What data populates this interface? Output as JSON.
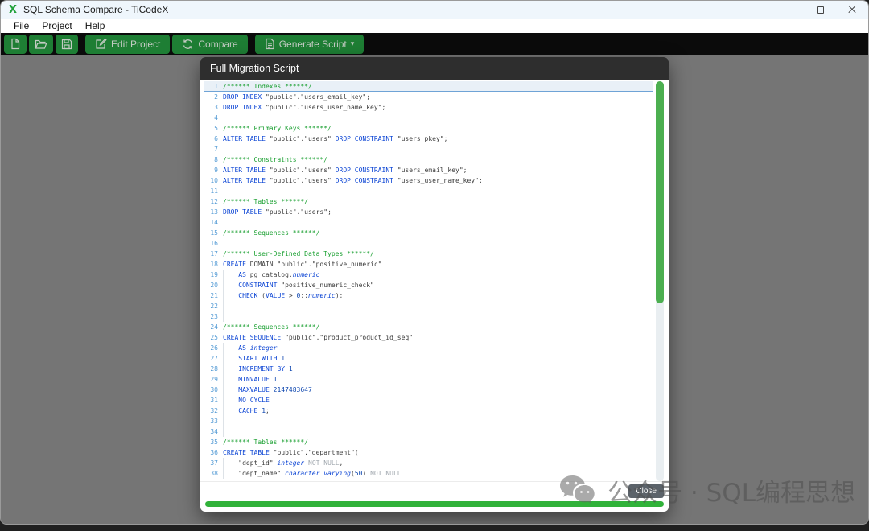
{
  "window": {
    "title": "SQL Schema Compare - TiCodeX",
    "logo_char": "X",
    "controls": [
      "minimize-icon",
      "maximize-icon",
      "close-icon"
    ]
  },
  "menu": {
    "items": [
      "File",
      "Project",
      "Help"
    ]
  },
  "toolbar": {
    "buttons": [
      {
        "id": "new-project",
        "icon": "new-file-icon",
        "label": ""
      },
      {
        "id": "open-project",
        "icon": "open-folder-icon",
        "label": ""
      },
      {
        "id": "save-project",
        "icon": "save-icon",
        "label": ""
      },
      {
        "id": "edit-project",
        "icon": "edit-pencil-icon",
        "label": "Edit Project"
      },
      {
        "id": "compare",
        "icon": "compare-sync-icon",
        "label": "Compare"
      },
      {
        "id": "generate-script",
        "icon": "script-file-icon",
        "label": "Generate Script",
        "caret": "▾"
      }
    ],
    "button_color": "#1e7e34"
  },
  "modal": {
    "title": "Full Migration Script",
    "close_label": "Close",
    "progress_color": "#31b23a",
    "scroll_thumb_color": "#4caf50",
    "code": {
      "lines": [
        {
          "hl": true,
          "g": false,
          "toks": [
            [
              "c",
              "/****** Indexes ******/"
            ]
          ]
        },
        {
          "g": false,
          "toks": [
            [
              "k",
              "DROP INDEX"
            ],
            [
              "p",
              " "
            ],
            [
              "s",
              "\"public\".\"users_email_key\""
            ],
            [
              "p",
              ";"
            ]
          ]
        },
        {
          "g": false,
          "toks": [
            [
              "k",
              "DROP INDEX"
            ],
            [
              "p",
              " "
            ],
            [
              "s",
              "\"public\".\"users_user_name_key\""
            ],
            [
              "p",
              ";"
            ]
          ]
        },
        {
          "g": false,
          "toks": []
        },
        {
          "g": false,
          "toks": [
            [
              "c",
              "/****** Primary Keys ******/"
            ]
          ]
        },
        {
          "g": false,
          "toks": [
            [
              "k",
              "ALTER TABLE"
            ],
            [
              "p",
              " "
            ],
            [
              "s",
              "\"public\".\"users\""
            ],
            [
              "p",
              " "
            ],
            [
              "k",
              "DROP CONSTRAINT"
            ],
            [
              "p",
              " "
            ],
            [
              "s",
              "\"users_pkey\""
            ],
            [
              "p",
              ";"
            ]
          ]
        },
        {
          "g": false,
          "toks": []
        },
        {
          "g": false,
          "toks": [
            [
              "c",
              "/****** Constraints ******/"
            ]
          ]
        },
        {
          "g": false,
          "toks": [
            [
              "k",
              "ALTER TABLE"
            ],
            [
              "p",
              " "
            ],
            [
              "s",
              "\"public\".\"users\""
            ],
            [
              "p",
              " "
            ],
            [
              "k",
              "DROP CONSTRAINT"
            ],
            [
              "p",
              " "
            ],
            [
              "s",
              "\"users_email_key\""
            ],
            [
              "p",
              ";"
            ]
          ]
        },
        {
          "g": false,
          "toks": [
            [
              "k",
              "ALTER TABLE"
            ],
            [
              "p",
              " "
            ],
            [
              "s",
              "\"public\".\"users\""
            ],
            [
              "p",
              " "
            ],
            [
              "k",
              "DROP CONSTRAINT"
            ],
            [
              "p",
              " "
            ],
            [
              "s",
              "\"users_user_name_key\""
            ],
            [
              "p",
              ";"
            ]
          ]
        },
        {
          "g": false,
          "toks": []
        },
        {
          "g": false,
          "toks": [
            [
              "c",
              "/****** Tables ******/"
            ]
          ]
        },
        {
          "g": false,
          "toks": [
            [
              "k",
              "DROP TABLE"
            ],
            [
              "p",
              " "
            ],
            [
              "s",
              "\"public\".\"users\""
            ],
            [
              "p",
              ";"
            ]
          ]
        },
        {
          "g": false,
          "toks": []
        },
        {
          "g": false,
          "toks": [
            [
              "c",
              "/****** Sequences ******/"
            ]
          ]
        },
        {
          "g": false,
          "toks": []
        },
        {
          "g": false,
          "toks": [
            [
              "c",
              "/****** User-Defined Data Types ******/"
            ]
          ]
        },
        {
          "g": false,
          "toks": [
            [
              "k",
              "CREATE"
            ],
            [
              "p",
              " DOMAIN "
            ],
            [
              "s",
              "\"public\".\"positive_numeric\""
            ]
          ]
        },
        {
          "g": true,
          "toks": [
            [
              "p",
              "    "
            ],
            [
              "k",
              "AS"
            ],
            [
              "p",
              " pg_catalog."
            ],
            [
              "t",
              "numeric"
            ]
          ]
        },
        {
          "g": true,
          "toks": [
            [
              "p",
              "    "
            ],
            [
              "k",
              "CONSTRAINT"
            ],
            [
              "p",
              " "
            ],
            [
              "s",
              "\"positive_numeric_check\""
            ]
          ]
        },
        {
          "g": true,
          "toks": [
            [
              "p",
              "    "
            ],
            [
              "k",
              "CHECK"
            ],
            [
              "p",
              " ("
            ],
            [
              "k",
              "VALUE"
            ],
            [
              "p",
              " > "
            ],
            [
              "n",
              "0"
            ],
            [
              "p",
              "::"
            ],
            [
              "t",
              "numeric"
            ],
            [
              "p",
              ");"
            ]
          ]
        },
        {
          "g": true,
          "toks": []
        },
        {
          "g": true,
          "toks": []
        },
        {
          "g": false,
          "toks": [
            [
              "c",
              "/****** Sequences ******/"
            ]
          ]
        },
        {
          "g": false,
          "toks": [
            [
              "k",
              "CREATE SEQUENCE"
            ],
            [
              "p",
              " "
            ],
            [
              "s",
              "\"public\".\"product_product_id_seq\""
            ]
          ]
        },
        {
          "g": true,
          "toks": [
            [
              "p",
              "    "
            ],
            [
              "k",
              "AS"
            ],
            [
              "p",
              " "
            ],
            [
              "t",
              "integer"
            ]
          ]
        },
        {
          "g": true,
          "toks": [
            [
              "p",
              "    "
            ],
            [
              "k",
              "START WITH"
            ],
            [
              "p",
              " "
            ],
            [
              "n",
              "1"
            ]
          ]
        },
        {
          "g": true,
          "toks": [
            [
              "p",
              "    "
            ],
            [
              "k",
              "INCREMENT BY"
            ],
            [
              "p",
              " "
            ],
            [
              "n",
              "1"
            ]
          ]
        },
        {
          "g": true,
          "toks": [
            [
              "p",
              "    "
            ],
            [
              "k",
              "MINVALUE"
            ],
            [
              "p",
              " "
            ],
            [
              "n",
              "1"
            ]
          ]
        },
        {
          "g": true,
          "toks": [
            [
              "p",
              "    "
            ],
            [
              "k",
              "MAXVALUE"
            ],
            [
              "p",
              " "
            ],
            [
              "n",
              "2147483647"
            ]
          ]
        },
        {
          "g": true,
          "toks": [
            [
              "p",
              "    "
            ],
            [
              "k",
              "NO CYCLE"
            ]
          ]
        },
        {
          "g": true,
          "toks": [
            [
              "p",
              "    "
            ],
            [
              "k",
              "CACHE"
            ],
            [
              "p",
              " "
            ],
            [
              "n",
              "1"
            ],
            [
              "p",
              ";"
            ]
          ]
        },
        {
          "g": true,
          "toks": []
        },
        {
          "g": true,
          "toks": []
        },
        {
          "g": false,
          "toks": [
            [
              "c",
              "/****** Tables ******/"
            ]
          ]
        },
        {
          "g": false,
          "toks": [
            [
              "k",
              "CREATE TABLE"
            ],
            [
              "p",
              " "
            ],
            [
              "s",
              "\"public\".\"department\""
            ],
            [
              "p",
              "("
            ]
          ]
        },
        {
          "g": true,
          "toks": [
            [
              "p",
              "    "
            ],
            [
              "s",
              "\"dept_id\""
            ],
            [
              "p",
              " "
            ],
            [
              "t",
              "integer"
            ],
            [
              "p",
              " "
            ],
            [
              "x",
              "NOT NULL"
            ],
            [
              "p",
              ","
            ]
          ]
        },
        {
          "g": true,
          "toks": [
            [
              "p",
              "    "
            ],
            [
              "s",
              "\"dept_name\""
            ],
            [
              "p",
              " "
            ],
            [
              "t",
              "character varying"
            ],
            [
              "p",
              "("
            ],
            [
              "n",
              "50"
            ],
            [
              "p",
              ")"
            ],
            [
              "p",
              " "
            ],
            [
              "x",
              "NOT NULL"
            ]
          ]
        }
      ]
    }
  },
  "watermark": {
    "icon": "wechat-icon",
    "text": "公众号 · SQL编程思想"
  }
}
